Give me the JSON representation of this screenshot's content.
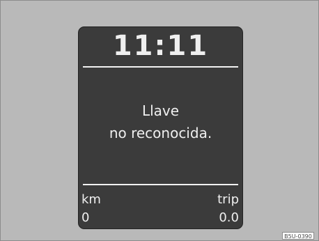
{
  "display": {
    "time": "11:11",
    "message_line_1": "Llave",
    "message_line_2": "no reconocida.",
    "left_label": "km",
    "right_label": "trip",
    "left_value": "0",
    "right_value": "0.0"
  },
  "caption": {
    "code": "B5U-0390"
  },
  "colors": {
    "background": "#b9b9b9",
    "screen": "#3b3b3b",
    "text": "#efefef"
  }
}
